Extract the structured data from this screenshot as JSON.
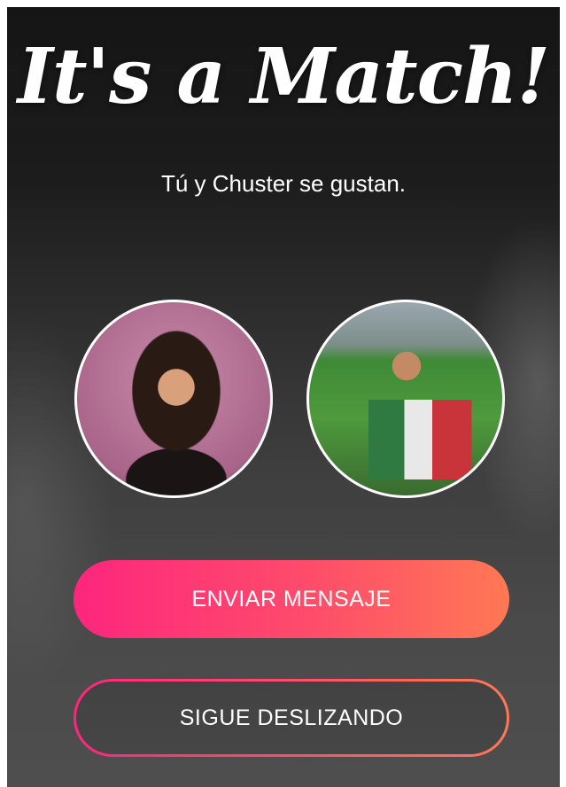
{
  "match": {
    "title": "It's a Match!",
    "subtitle": "Tú y Chuster se gustan."
  },
  "avatars": {
    "left_desc": "user-photo",
    "right_desc": "match-photo"
  },
  "buttons": {
    "send_message": "ENVIAR MENSAJE",
    "keep_swiping": "SIGUE DESLIZANDO"
  },
  "colors": {
    "gradient_start": "#fd267d",
    "gradient_end": "#ff7854",
    "text": "#ffffff"
  }
}
